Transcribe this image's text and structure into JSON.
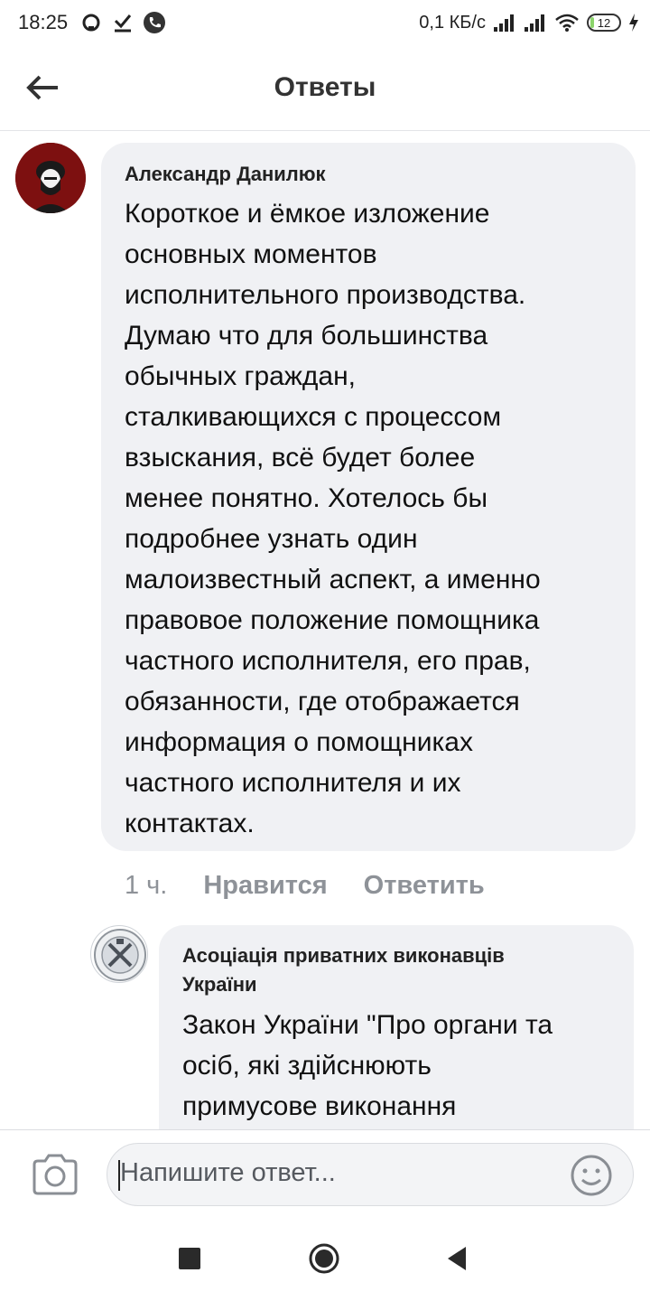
{
  "status_bar": {
    "time": "18:25",
    "speed": "0,1 КБ/с",
    "battery": "12",
    "battery_level": 0.12
  },
  "header": {
    "title": "Ответы"
  },
  "comment": {
    "author": "Александр Данилюк",
    "text": "Короткое и ёмкое изложение\nосновных моментов\nисполнительного производства.\nДумаю что для большинства\nобычных граждан,\nсталкивающихся с процессом\nвзыскания, всё будет более\nменее понятно. Хотелось бы\nподробнее  узнать один\nмалоизвестный аспект, а именно\nправовое положение помощника\nчастного исполнителя, его прав,\nобязанности, где отображается\nинформация о помощниках\nчастного исполнителя и их\nконтактах.",
    "time": "1 ч.",
    "like_label": "Нравится",
    "reply_label": "Ответить"
  },
  "reply": {
    "author": "Асоціація приватних виконавців\nУкраїни",
    "text": "Закон України \"Про органи та\nосіб, які здійснюють\nпримусове виконання"
  },
  "composer": {
    "placeholder": "Напишите ответ..."
  },
  "icons": {
    "back": "back-arrow-icon",
    "camera": "camera-icon",
    "emoji": "emoji-icon",
    "nav_recent": "square-icon",
    "nav_home": "circle-icon",
    "nav_back": "triangle-icon"
  },
  "colors": {
    "bubble": "#f0f1f4",
    "meta_text": "#8e9298",
    "battery_fill": "#8bd46b"
  }
}
